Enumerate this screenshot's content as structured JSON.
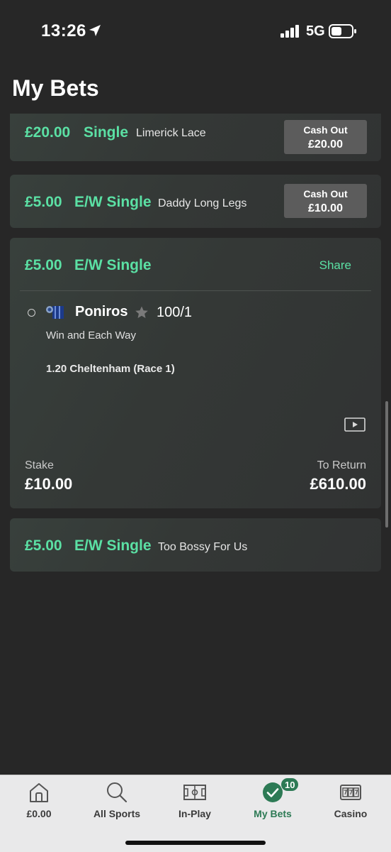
{
  "status_bar": {
    "time": "13:26",
    "network": "5G"
  },
  "header": {
    "title": "My Bets"
  },
  "bets": [
    {
      "amount": "£20.00",
      "type": "Single",
      "selection": "Limerick Lace",
      "cashout_label": "Cash Out",
      "cashout_value": "£20.00"
    },
    {
      "amount": "£5.00",
      "type": "E/W Single",
      "selection": "Daddy Long Legs",
      "cashout_label": "Cash Out",
      "cashout_value": "£10.00"
    },
    {
      "amount": "£5.00",
      "type": "E/W Single",
      "share_label": "Share",
      "horse": "Poniros",
      "odds": "100/1",
      "market": "Win and Each Way",
      "race": "1.20 Cheltenham (Race 1)",
      "stake_label": "Stake",
      "stake_value": "£10.00",
      "return_label": "To Return",
      "return_value": "£610.00"
    },
    {
      "amount": "£5.00",
      "type": "E/W Single",
      "selection": "Too Bossy For Us"
    }
  ],
  "tab_bar": {
    "tabs": [
      {
        "label": "£0.00",
        "icon": "home-icon"
      },
      {
        "label": "All Sports",
        "icon": "search-icon"
      },
      {
        "label": "In-Play",
        "icon": "pitch-icon"
      },
      {
        "label": "My Bets",
        "icon": "check-circle-icon",
        "badge": "10",
        "active": true
      },
      {
        "label": "Casino",
        "icon": "slot-machine-icon"
      }
    ]
  },
  "colors": {
    "accent": "#5be0a4",
    "active_tab": "#2d7a55",
    "background": "#272727"
  }
}
